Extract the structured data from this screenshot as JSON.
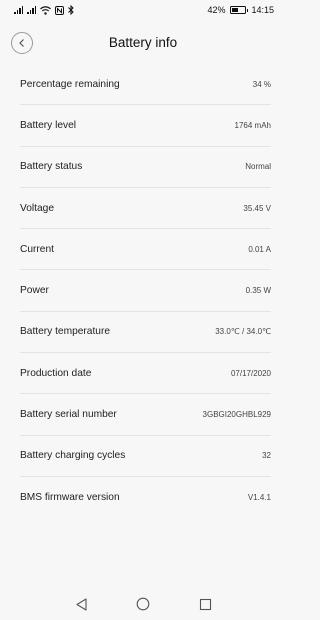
{
  "status_bar": {
    "battery_percent_text": "42%",
    "battery_level": 0.42,
    "time": "14:15",
    "icons": [
      "signal-icon",
      "signal-icon",
      "wifi-icon",
      "nfc-icon",
      "bluetooth-icon",
      "battery-icon"
    ]
  },
  "header": {
    "title": "Battery info",
    "back_icon": "chevron-left-icon"
  },
  "rows": [
    {
      "label": "Percentage remaining",
      "value": "34 %"
    },
    {
      "label": "Battery level",
      "value": "1764 mAh"
    },
    {
      "label": "Battery status",
      "value": "Normal"
    },
    {
      "label": "Voltage",
      "value": "35.45 V"
    },
    {
      "label": "Current",
      "value": "0.01 A"
    },
    {
      "label": "Power",
      "value": "0.35 W"
    },
    {
      "label": "Battery temperature",
      "value": "33.0℃ / 34.0℃"
    },
    {
      "label": "Production date",
      "value": "07/17/2020"
    },
    {
      "label": "Battery serial number",
      "value": "3GBGI20GHBL929"
    },
    {
      "label": "Battery charging cycles",
      "value": "32"
    },
    {
      "label": "BMS firmware version",
      "value": "V1.4.1"
    }
  ],
  "nav_bar": {
    "icons": [
      "back-triangle-icon",
      "home-circle-icon",
      "recents-square-icon"
    ]
  },
  "colors": {
    "background": "#f7f7f7",
    "divider": "#e3e3e3",
    "text": "#1e1e1e"
  }
}
